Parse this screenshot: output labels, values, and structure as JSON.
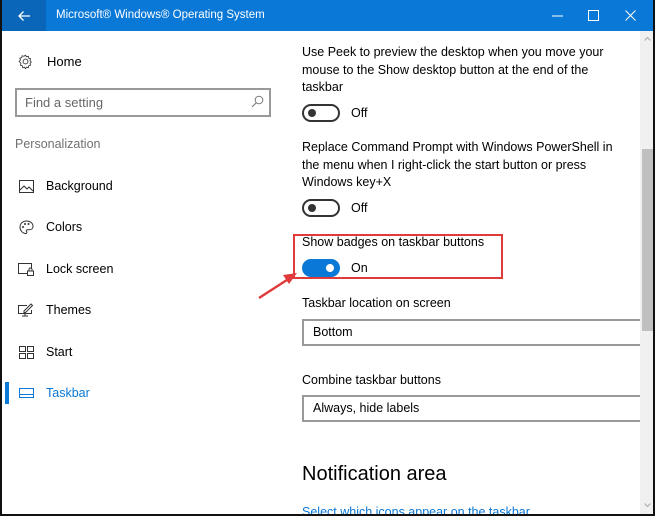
{
  "window": {
    "title": "Microsoft® Windows® Operating System",
    "back_icon": "arrow-left-icon",
    "minimize_icon": "minimize-icon",
    "maximize_icon": "maximize-icon",
    "close_icon": "close-icon",
    "accent_color": "#0a78d7"
  },
  "sidebar": {
    "home": {
      "label": "Home",
      "icon": "gear-icon"
    },
    "search": {
      "placeholder": "Find a setting",
      "value": "",
      "icon": "search-icon"
    },
    "section_label": "Personalization",
    "items": [
      {
        "label": "Background",
        "icon": "picture-icon",
        "active": false
      },
      {
        "label": "Colors",
        "icon": "palette-icon",
        "active": false
      },
      {
        "label": "Lock screen",
        "icon": "lock-screen-icon",
        "active": false
      },
      {
        "label": "Themes",
        "icon": "themes-icon",
        "active": false
      },
      {
        "label": "Start",
        "icon": "start-tiles-icon",
        "active": false
      },
      {
        "label": "Taskbar",
        "icon": "taskbar-icon",
        "active": true
      }
    ]
  },
  "content": {
    "settings": [
      {
        "description": "Use Peek to preview the desktop when you move your mouse to the Show desktop button at the end of the taskbar",
        "state": "Off",
        "on": false
      },
      {
        "description": "Replace Command Prompt with Windows PowerShell in the menu when I right-click the start button or press Windows key+X",
        "state": "Off",
        "on": false
      },
      {
        "description": "Show badges on taskbar buttons",
        "state": "On",
        "on": true
      }
    ],
    "taskbar_location": {
      "label": "Taskbar location on screen",
      "value": "Bottom"
    },
    "combine_buttons": {
      "label": "Combine taskbar buttons",
      "value": "Always, hide labels"
    },
    "notification_area": {
      "heading": "Notification area",
      "link": "Select which icons appear on the taskbar"
    }
  },
  "annotation": {
    "highlight_color": "#e03a3a",
    "target": "Show badges on taskbar buttons"
  }
}
